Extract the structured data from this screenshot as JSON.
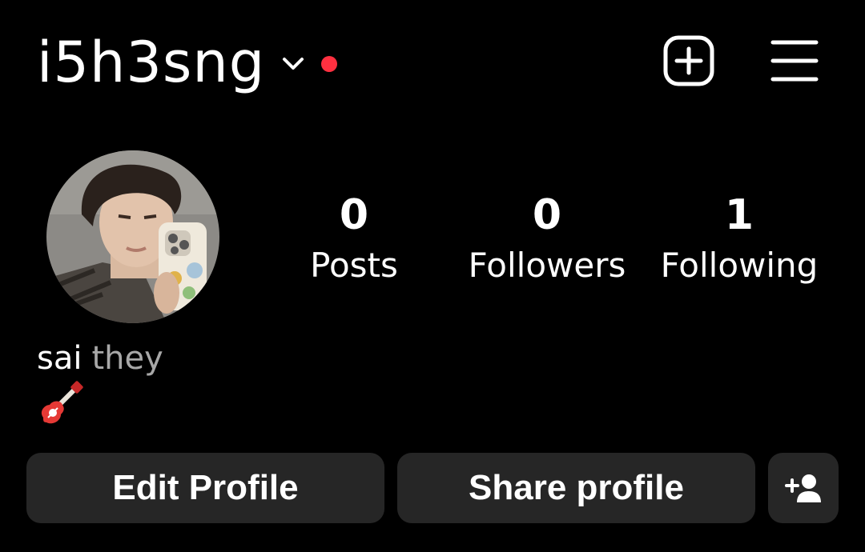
{
  "header": {
    "username": "i5h3sng",
    "has_notification_dot": true,
    "icons": {
      "account_switch": "chevron-down-icon",
      "new_post": "plus-square-icon",
      "menu": "hamburger-menu-icon"
    }
  },
  "profile": {
    "avatar_alt": "profile photo",
    "stats": [
      {
        "value": "0",
        "label": "Posts"
      },
      {
        "value": "0",
        "label": "Followers"
      },
      {
        "value": "1",
        "label": "Following"
      }
    ]
  },
  "bio": {
    "name": "sai",
    "pronouns": "they",
    "emoji": "guitar-icon"
  },
  "actions": {
    "edit_profile": "Edit Profile",
    "share_profile": "Share profile",
    "discover_people_icon": "add-person-icon"
  },
  "colors": {
    "background": "#000000",
    "button_bg": "#262626",
    "notification_dot": "#ff3040",
    "pronoun_text": "#a8a8a8"
  }
}
